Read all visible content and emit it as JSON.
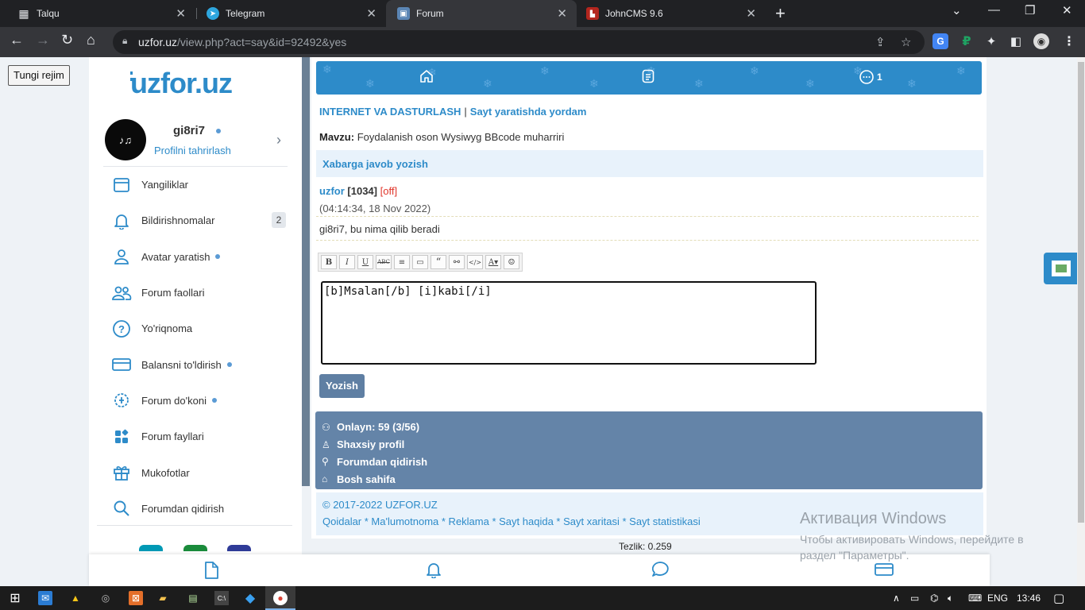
{
  "browser": {
    "tabs": [
      {
        "title": "Talqu",
        "icon": "grid-icon"
      },
      {
        "title": "Telegram",
        "icon": "telegram-icon"
      },
      {
        "title": "Forum",
        "icon": "forum-icon"
      },
      {
        "title": "JohnCMS 9.6",
        "icon": "johncms-icon"
      }
    ],
    "active_tab": 2,
    "url_host": "uzfor.uz",
    "url_path": "/view.php?act=say&id=92492&yes"
  },
  "page": {
    "dark_mode_btn": "Tungi rejim",
    "logo": "uzfor.uz",
    "profile": {
      "username": "gi8ri7",
      "edit_link": "Profilni tahrirlash"
    },
    "menu": [
      {
        "label": "Yangiliklar",
        "icon": "news-icon",
        "dot": false,
        "badge": ""
      },
      {
        "label": "Bildirishnomalar",
        "icon": "bell-icon",
        "dot": false,
        "badge": "2"
      },
      {
        "label": "Avatar yaratish",
        "icon": "user-icon",
        "dot": true,
        "badge": ""
      },
      {
        "label": "Forum faollari",
        "icon": "users-icon",
        "dot": false,
        "badge": ""
      },
      {
        "label": "Yo'riqnoma",
        "icon": "help-icon",
        "dot": false,
        "badge": ""
      },
      {
        "label": "Balansni to'ldirish",
        "icon": "card-icon",
        "dot": true,
        "badge": ""
      },
      {
        "label": "Forum do'koni",
        "icon": "shop-icon",
        "dot": true,
        "badge": ""
      },
      {
        "label": "Forum fayllari",
        "icon": "files-icon",
        "dot": false,
        "badge": ""
      },
      {
        "label": "Mukofotlar",
        "icon": "gift-icon",
        "dot": false,
        "badge": ""
      },
      {
        "label": "Forumdan qidirish",
        "icon": "search-icon",
        "dot": false,
        "badge": ""
      }
    ],
    "nav": {
      "messages_count": "1"
    },
    "breadcrumb": {
      "section": "INTERNET VA DASTURLASH",
      "separator": "|",
      "subsection": "Sayt yaratishda yordam"
    },
    "topic": {
      "label": "Mavzu:",
      "title": "Foydalanish oson Wysiwyg BBcode muharriri"
    },
    "reply_header": "Xabarga javob yozish",
    "quoted_post": {
      "author": "uzfor",
      "rank": "[1034]",
      "status": "[off]",
      "date": "(04:14:34, 18 Nov 2022)",
      "text": "gi8ri7, bu nima qilib beradi"
    },
    "bbcode_buttons": [
      "B",
      "I",
      "U",
      "ABC",
      "≡",
      "▭",
      "“",
      "⚯",
      "</>",
      "A▾",
      "☺"
    ],
    "editor_text": "[b]Msalan[/b] [i]kabi[/i]",
    "submit": "Yozish",
    "info": [
      {
        "icon": "users-icon",
        "text": "Onlayn: 59 (3/56)"
      },
      {
        "icon": "user-icon",
        "text": "Shaxsiy profil"
      },
      {
        "icon": "search-icon",
        "text": "Forumdan qidirish"
      },
      {
        "icon": "home-icon",
        "text": "Bosh sahifa"
      }
    ],
    "footer": {
      "copyright": "© 2017-2022 UZFOR.UZ",
      "links": "Qoidalar * Ma'lumotnoma * Reklama * Sayt haqida * Sayt xaritasi * Sayt statistikasi"
    },
    "speed": "Tezlik: 0.259"
  },
  "watermark": {
    "line1": "Активация Windows",
    "line2": "Чтобы активировать Windows, перейдите в",
    "line3": "раздел \"Параметры\"."
  },
  "taskbar": {
    "lang": "ENG",
    "time": "13:46"
  },
  "colors": {
    "accent": "#2d8bc9",
    "info_box": "#6484a8",
    "off_status": "#e0362b"
  }
}
